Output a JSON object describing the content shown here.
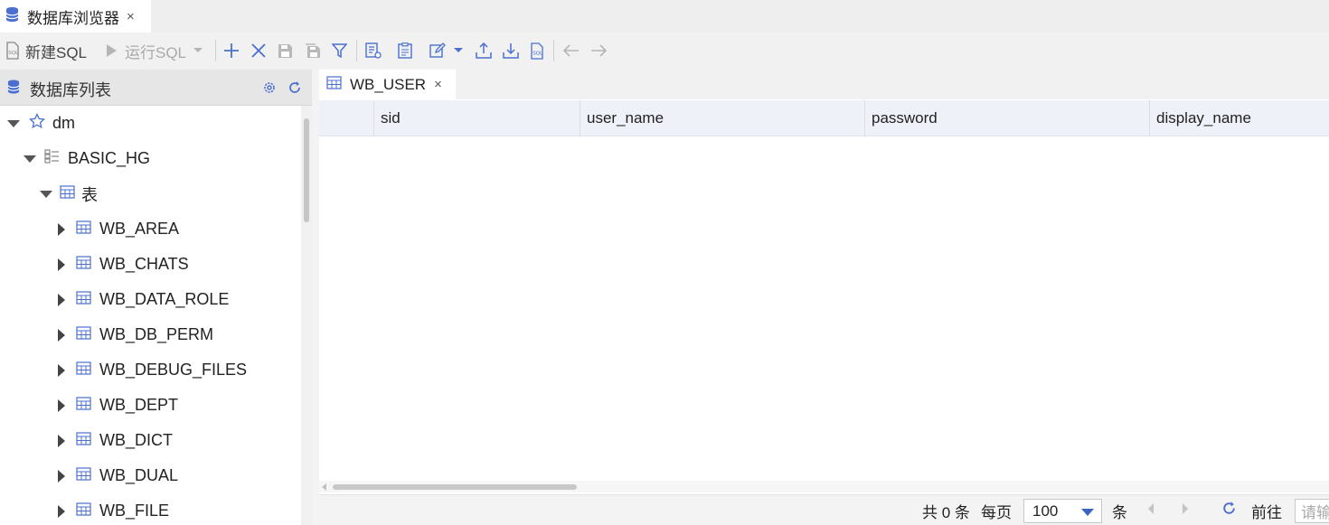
{
  "window": {
    "tab_title": "数据库浏览器",
    "tab_close": "×"
  },
  "toolbar": {
    "new_sql_label": "新建SQL",
    "run_sql_label": "运行SQL",
    "icons": [
      "sql-file-icon",
      "play-icon",
      "chevron-down-icon",
      "add-icon",
      "delete-icon",
      "save-icon",
      "save-all-icon",
      "filter-icon",
      "table-edit-icon",
      "clipboard-icon",
      "edit-icon",
      "chevron-down-icon",
      "export-icon",
      "import-icon",
      "sql-export-icon",
      "back-icon",
      "forward-icon"
    ]
  },
  "sidebar": {
    "title": "数据库列表",
    "tree": [
      {
        "label": "dm",
        "icon": "star-icon",
        "expanded": true,
        "level": 0
      },
      {
        "label": "BASIC_HG",
        "icon": "schema-icon",
        "expanded": true,
        "level": 1
      },
      {
        "label": "表",
        "icon": "table-icon",
        "expanded": true,
        "level": 2
      },
      {
        "label": "WB_AREA",
        "icon": "table-icon",
        "expanded": false,
        "level": 3
      },
      {
        "label": "WB_CHATS",
        "icon": "table-icon",
        "expanded": false,
        "level": 3
      },
      {
        "label": "WB_DATA_ROLE",
        "icon": "table-icon",
        "expanded": false,
        "level": 3
      },
      {
        "label": "WB_DB_PERM",
        "icon": "table-icon",
        "expanded": false,
        "level": 3
      },
      {
        "label": "WB_DEBUG_FILES",
        "icon": "table-icon",
        "expanded": false,
        "level": 3
      },
      {
        "label": "WB_DEPT",
        "icon": "table-icon",
        "expanded": false,
        "level": 3
      },
      {
        "label": "WB_DICT",
        "icon": "table-icon",
        "expanded": false,
        "level": 3
      },
      {
        "label": "WB_DUAL",
        "icon": "table-icon",
        "expanded": false,
        "level": 3
      },
      {
        "label": "WB_FILE",
        "icon": "table-icon",
        "expanded": false,
        "level": 3
      }
    ]
  },
  "editor": {
    "tab_label": "WB_USER",
    "tab_close": "×",
    "columns": [
      "sid",
      "user_name",
      "password",
      "display_name"
    ]
  },
  "pager": {
    "total_text": "共 0 条",
    "per_page_label": "每页",
    "page_size": "100",
    "unit": "条",
    "goto_label": "前往",
    "goto_placeholder": "请输"
  },
  "colors": {
    "accent": "#3b63c4",
    "icon_blue": "#4a6fd0",
    "header_bg": "#eef1f8"
  }
}
